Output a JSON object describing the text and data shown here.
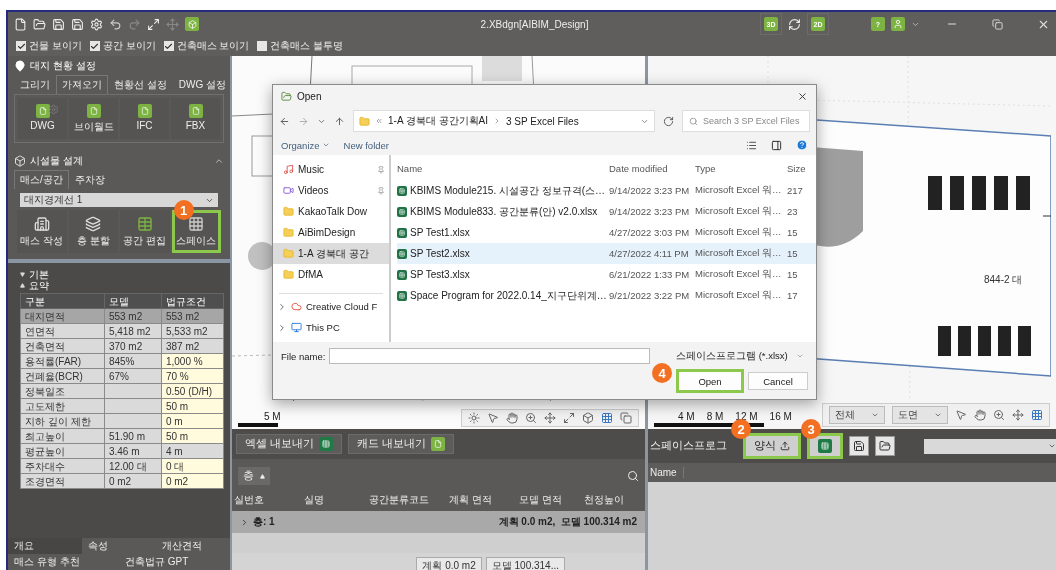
{
  "window": {
    "title": "2.XBdgn[AIBIM_Design]",
    "view_modes": [
      {
        "label": "3D",
        "kind": "badge"
      },
      {
        "kind": "sync"
      },
      {
        "label": "2D",
        "kind": "badge"
      }
    ],
    "help": "?"
  },
  "display_options": [
    {
      "label": "건물 보이기",
      "checked": true
    },
    {
      "label": "공간 보이기",
      "checked": true
    },
    {
      "label": "건축매스 보이기",
      "checked": true
    },
    {
      "label": "건축매스 불투명",
      "checked": false
    }
  ],
  "site_setup": {
    "title": "대지 현황 설정",
    "tabs": [
      {
        "label": "그리기",
        "selected": false
      },
      {
        "label": "가져오기",
        "selected": true
      },
      {
        "label": "현황선 설정",
        "selected": false
      },
      {
        "label": "DWG 설정",
        "selected": false
      }
    ],
    "imports": [
      {
        "label": "DWG",
        "settings": true
      },
      {
        "label": "브이월드",
        "settings": false
      },
      {
        "label": "IFC",
        "settings": false
      },
      {
        "label": "FBX",
        "settings": false
      }
    ]
  },
  "facility_design": {
    "title": "시설물 설계",
    "expanded": true,
    "tabs": [
      {
        "label": "매스/공간",
        "selected": true
      },
      {
        "label": "주차장",
        "selected": false
      }
    ],
    "boundary": "대지경계선 1",
    "tools": [
      {
        "label": "매스 작성",
        "kind": "mass",
        "highlighted": false
      },
      {
        "label": "층 분할",
        "kind": "floors",
        "highlighted": false
      },
      {
        "label": "공간 편집",
        "kind": "edit",
        "highlighted": false
      },
      {
        "label": "스페이스",
        "kind": "grid",
        "highlighted": true,
        "badge": "1"
      }
    ]
  },
  "properties": {
    "groups": [
      {
        "label": "기본",
        "expanded": false
      },
      {
        "label": "요약",
        "expanded": true
      }
    ],
    "columns": [
      "구분",
      "모델",
      "법규조건"
    ],
    "rows": [
      {
        "cells": [
          "대지면적",
          "553 m2",
          "553 m2"
        ],
        "selected": true,
        "editable": false
      },
      {
        "cells": [
          "연면적",
          "5,418 m2",
          "5,533 m2"
        ],
        "selected": false,
        "editable": false
      },
      {
        "cells": [
          "건축면적",
          "370 m2",
          "387 m2"
        ],
        "selected": false,
        "editable": false
      },
      {
        "cells": [
          "용적률(FAR)",
          "845%",
          "1,000 %"
        ],
        "selected": false,
        "editable": true
      },
      {
        "cells": [
          "건폐율(BCR)",
          "67%",
          "70 %"
        ],
        "selected": false,
        "editable": true
      },
      {
        "cells": [
          "정북일조",
          "",
          "0.50 (D/H)"
        ],
        "selected": false,
        "editable": true
      },
      {
        "cells": [
          "고도제한",
          "",
          "50 m"
        ],
        "selected": false,
        "editable": true
      },
      {
        "cells": [
          "지하 깊이 제한",
          "",
          "0 m"
        ],
        "selected": false,
        "editable": true
      },
      {
        "cells": [
          "최고높이",
          "51.90 m",
          "50 m"
        ],
        "selected": false,
        "editable": true
      },
      {
        "cells": [
          "평균높이",
          "3.46 m",
          "4 m"
        ],
        "selected": false,
        "editable": false
      },
      {
        "cells": [
          "주차대수",
          "12.00 대",
          "0 대"
        ],
        "selected": false,
        "editable": true
      },
      {
        "cells": [
          "조경면적",
          "0 m2",
          "0 m2"
        ],
        "selected": false,
        "editable": true
      }
    ]
  },
  "bottom_tabs": [
    {
      "label": "개요",
      "selected": true
    },
    {
      "label": "속성",
      "selected": false
    },
    {
      "label": "개산견적",
      "selected": false
    }
  ],
  "bottom_links": [
    "매스 유형 추천",
    "건축법규 GPT"
  ],
  "site_view": {
    "scale_label": "5 M"
  },
  "plan_view": {
    "scale_labels": [
      "4 M",
      "8 M",
      "12 M",
      "16 M"
    ],
    "lot_label": "844-2 대",
    "filters": [
      "전체",
      "도면"
    ]
  },
  "dialog": {
    "title": "Open",
    "path": [
      "1-A 경북대 공간기획AI",
      "3 SP Excel Files"
    ],
    "search_placeholder": "Search 3 SP Excel Files",
    "organize": "Organize",
    "new_folder": "New folder",
    "nav": [
      {
        "label": "Music",
        "kind": "music",
        "pinned": true,
        "selected": false
      },
      {
        "label": "Videos",
        "kind": "video",
        "pinned": true,
        "selected": false
      },
      {
        "label": "KakaoTalk Dow",
        "kind": "folder",
        "pinned": false,
        "selected": false
      },
      {
        "label": "AiBimDesign",
        "kind": "folder",
        "pinned": false,
        "selected": false
      },
      {
        "label": "1-A 경북대 공간",
        "kind": "folder",
        "pinned": false,
        "selected": true
      },
      {
        "label": "DfMA",
        "kind": "folder",
        "pinned": false,
        "selected": false
      }
    ],
    "tree": [
      {
        "label": "Creative Cloud F",
        "kind": "cloud",
        "expanded": false
      },
      {
        "label": "This PC",
        "kind": "pc",
        "expanded": false
      }
    ],
    "columns": [
      "Name",
      "Date modified",
      "Type",
      "Size"
    ],
    "files": [
      {
        "name": "KBIMS Module215. 시설공간 정보규격(스…",
        "date": "9/14/2022 3:23 PM",
        "type": "Microsoft Excel 워…",
        "size": "217",
        "selected": false
      },
      {
        "name": "KBIMS Module833. 공간분류(안) v2.0.xlsx",
        "date": "9/14/2022 3:23 PM",
        "type": "Microsoft Excel 워…",
        "size": "23",
        "selected": false
      },
      {
        "name": "SP Test1.xlsx",
        "date": "4/27/2022 3:03 PM",
        "type": "Microsoft Excel 워…",
        "size": "15",
        "selected": false
      },
      {
        "name": "SP Test2.xlsx",
        "date": "4/27/2022 4:11 PM",
        "type": "Microsoft Excel 워…",
        "size": "15",
        "selected": true
      },
      {
        "name": "SP Test3.xlsx",
        "date": "6/21/2022 1:33 PM",
        "type": "Microsoft Excel 워…",
        "size": "15",
        "selected": false
      },
      {
        "name": "Space Program for 2022.0.14_지구단위계…",
        "date": "9/21/2022 3:22 PM",
        "type": "Microsoft Excel 워…",
        "size": "17",
        "selected": false
      }
    ],
    "file_name_label": "File name:",
    "filter": "스페이스프로그램 (*.xlsx)",
    "open_button": {
      "label": "Open",
      "highlighted": true,
      "badge": "4"
    },
    "cancel_button": "Cancel"
  },
  "space_list": {
    "exports": [
      {
        "label": "엑셀 내보내기",
        "kind": "excel"
      },
      {
        "label": "캐드 내보내기",
        "kind": "dwg"
      }
    ],
    "floor_filter": "층",
    "columns": [
      "실번호",
      "실명",
      "공간분류코드",
      "계획 면적",
      "모델 면적",
      "천정높이"
    ],
    "group": {
      "label": "층: 1",
      "summary": "계획 0.0 m2,  모델 100.314 m2",
      "expanded": false
    },
    "totals": [
      "계획 0.0 m2",
      "모델 100.314..."
    ]
  },
  "space_program": {
    "title": "스페이스프로그",
    "template_button": {
      "label": "양식",
      "highlighted": true,
      "badge": "2"
    },
    "excel_button": {
      "highlighted": true,
      "badge": "3"
    },
    "columns": [
      "Name"
    ]
  }
}
